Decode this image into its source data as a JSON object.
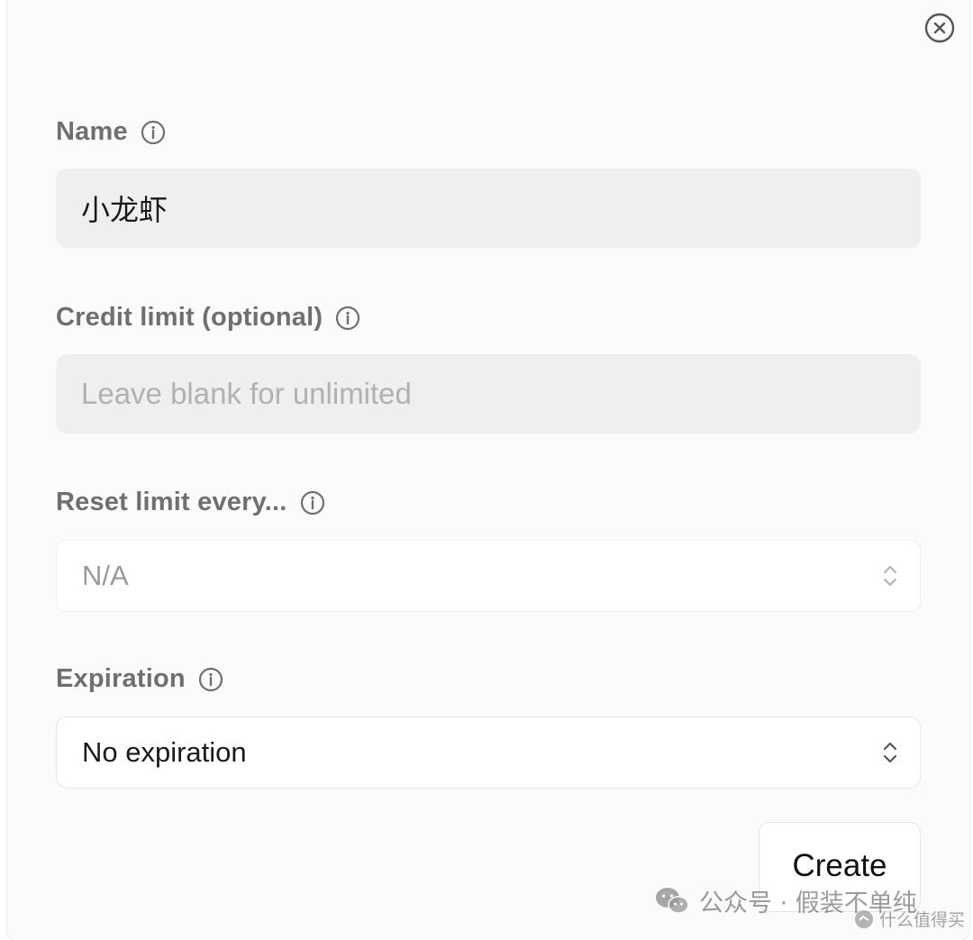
{
  "form": {
    "name": {
      "label": "Name",
      "value": "小龙虾"
    },
    "credit_limit": {
      "label": "Credit limit (optional)",
      "placeholder": "Leave blank for unlimited"
    },
    "reset_limit": {
      "label": "Reset limit every...",
      "value": "N/A"
    },
    "expiration": {
      "label": "Expiration",
      "value": "No expiration"
    },
    "create_label": "Create"
  },
  "watermark": {
    "main": "公众号 · 假装不单纯",
    "secondary": "什么值得买"
  },
  "colors": {
    "label": "#6f6f6f",
    "input_bg": "#efeff0",
    "placeholder": "#b1b1b4"
  },
  "icons": {
    "close": "close-icon",
    "info": "info-icon",
    "select": "chevron-up-down-icon"
  }
}
